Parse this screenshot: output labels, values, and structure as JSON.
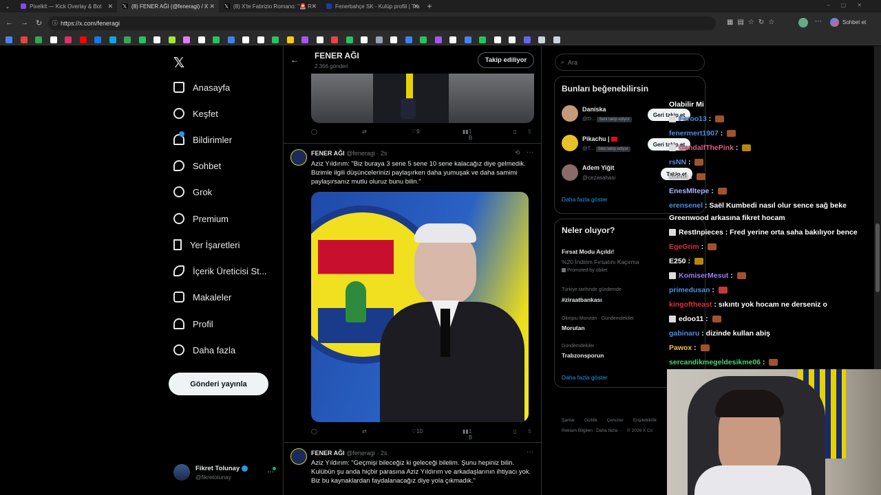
{
  "browser": {
    "tabs": [
      {
        "label": "Pixelkit — Kick Overlay & Bot",
        "color": "#7a4df0"
      },
      {
        "label": "(8) FENER AĞI (@feneragi) / X",
        "color": "#e7e9ea"
      },
      {
        "label": "(8) X'te Fabrizio Romano: \"🚨 R",
        "color": "#e7e9ea"
      },
      {
        "label": "Fenerbahçe SK - Kulüp profili | Tra",
        "color": "#1a3ca8"
      }
    ],
    "url": "https://x.com/feneragi",
    "profile_label": "Sohbet et"
  },
  "nav": {
    "items": [
      "Anasayfa",
      "Keşfet",
      "Bildirimler",
      "Sohbet",
      "Grok",
      "Premium",
      "Yer İşaretleri",
      "İçerik Üreticisi St...",
      "Makaleler",
      "Profil",
      "Daha fazla"
    ],
    "post_button": "Gönderi yayınla"
  },
  "account": {
    "name": "Fikret Tolunay",
    "handle": "@fikretolunay"
  },
  "header": {
    "title": "FENER AĞI",
    "subtitle": "2.366 gönderi",
    "follow_button": "Takip ediliyor"
  },
  "tweets": [
    {
      "author": "FENER AĞI",
      "handle": "@feneragi",
      "time": "· 2s",
      "line1": "Aziz Yıldırım: \"Biz buraya 3 sene 5 sene 10 sene kalacağız diye gelmedik.",
      "line2": "Bizimle ilgili düşüncelerinizi paylaşırken daha yumuşak ve daha samimi",
      "line3": "paylaşırsanız mutlu oluruz bunu bilin.\"",
      "likes": "10",
      "views": "1 B"
    },
    {
      "author": "FENER AĞI",
      "handle": "@feneragi",
      "time": "· 2s",
      "line1": "Aziz Yıldırım: \"Geçmişi bileceğiz ki geleceği bilelim. Şunu hepiniz bilin.",
      "line2": "Kulübün şu anda hiçbir parasına Aziz Yıldırım ve arkadaşlarının ihtiyacı yok.",
      "line3": "Biz bu kaynaklardan faydalanacağız diye yola çıkmadık.\""
    }
  ],
  "top_actions": {
    "likes": "9",
    "views": "1 B"
  },
  "search": {
    "placeholder": "Ara"
  },
  "suggestions": {
    "title": "Bunları beğenebilirsin",
    "users": [
      {
        "name": "Daniska",
        "handle": "@D...",
        "badge": "Seni takip ediyor",
        "button": "Geri takip et"
      },
      {
        "name": "Pikachu |",
        "handle": "@T...",
        "badge": "Seni takip ediyor",
        "button": "Geri takip et"
      },
      {
        "name": "Adem Yiğit",
        "handle": "@cezasahasi",
        "button": "Takip et"
      }
    ],
    "more": "Daha fazla göster"
  },
  "trends": {
    "title": "Neler oluyor?",
    "items": [
      {
        "context": "",
        "name": "Fırsat Modu Açıldı!",
        "desc": "%20 İndirim Fırsatını Kaçırma",
        "promo": "Promoted by obilet"
      },
      {
        "context": "Türkiye tarihinde gündemde",
        "name": "#ziraatbankası"
      },
      {
        "context": "Olimpiu Morutan · Gündemdekiler",
        "name": "Morutan"
      },
      {
        "context": "Gündemdekiler",
        "name": "Trabzonsporun"
      }
    ],
    "more": "Daha fazla göster"
  },
  "footer": {
    "line1": [
      "Şartlar",
      "Gizlilik",
      "Çerezler",
      "Erişilebilirlik"
    ],
    "line2": [
      "Reklam Bilgileri",
      "Daha fazla ···",
      "© 2026 X Co"
    ]
  },
  "chat": [
    {
      "user": "Olabilir Mi",
      "color": "#ffffff",
      "msg": ""
    },
    {
      "user": "Feroo13",
      "color": "#4a90e2",
      "msg": " : "
    },
    {
      "user": "fenermert1907",
      "color": "#4a90e2",
      "msg": " : "
    },
    {
      "user": "GandalfThePink",
      "color": "#e05a8c",
      "msg": " : "
    },
    {
      "user": "rsNN",
      "color": "#4a90e2",
      "msg": " : "
    },
    {
      "user": "kleno",
      "color": "#e0e0e0",
      "msg": " : "
    },
    {
      "user": "EnesMltepe",
      "color": "#b0b0ff",
      "msg": " : "
    },
    {
      "user": "erensenel",
      "color": "#4a90e2",
      "msg": " : Saël Kumbedi nasıl olur sence sağ beke"
    },
    {
      "user": "",
      "color": "#ffffff",
      "msg": "Greenwood arkasına fikret hocam"
    },
    {
      "user": "RestInpieces",
      "color": "#ffffff",
      "msg": " : Fred yerine orta saha bakılıyor bence"
    },
    {
      "user": "EgeGrim",
      "color": "#e0303a",
      "msg": " : "
    },
    {
      "user": "E250",
      "color": "#ffffff",
      "msg": " : "
    },
    {
      "user": "KomiserMesut",
      "color": "#9a7ff0",
      "msg": " : "
    },
    {
      "user": "primedusan",
      "color": "#4a90e2",
      "msg": " : "
    },
    {
      "user": "kingoftheast",
      "color": "#e0303a",
      "msg": " : sıkıntı yok hocam ne derseniz o"
    },
    {
      "user": "edoo11",
      "color": "#ffffff",
      "msg": " : "
    },
    {
      "user": "gabinaru",
      "color": "#4a90e2",
      "msg": " : dizinde kullan abiş"
    },
    {
      "user": "Pawox",
      "color": "#f0c040",
      "msg": " : "
    },
    {
      "user": "sercandikmegeldesikme06",
      "color": "#4ad27a",
      "msg": " : "
    }
  ]
}
